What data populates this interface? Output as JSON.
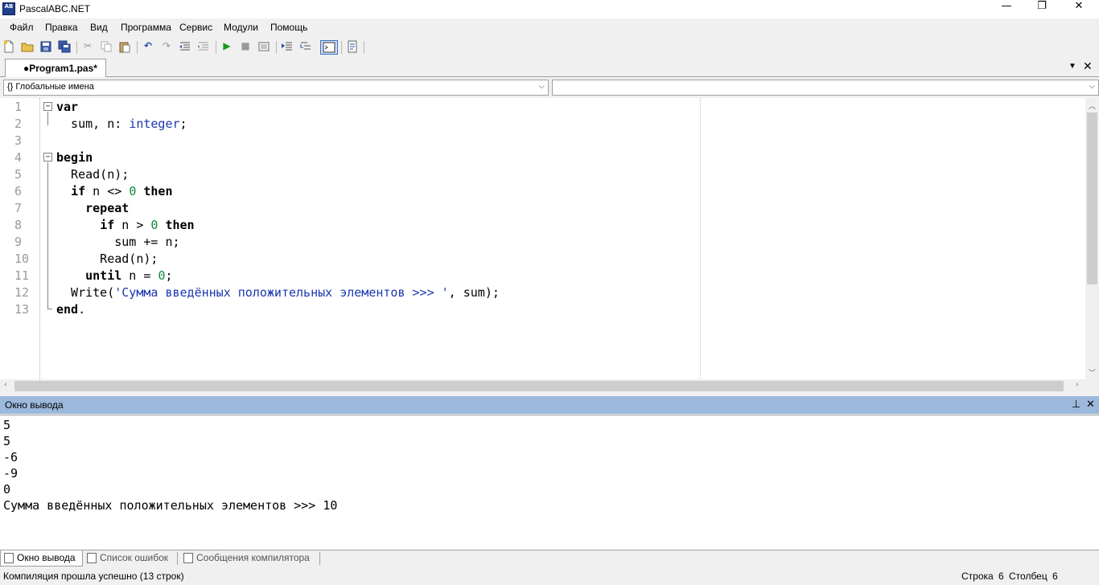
{
  "window": {
    "title": "PascalABC.NET",
    "icon_text": "AB",
    "min": "—",
    "max": "❐",
    "close": "✕"
  },
  "menu": [
    "Файл",
    "Правка",
    "Вид",
    "Программа",
    "Сервис",
    "Модули",
    "Помощь"
  ],
  "toolbar_icons": [
    "new-file-icon",
    "open-file-icon",
    "save-icon",
    "save-all-icon",
    "cut-icon",
    "copy-icon",
    "paste-icon",
    "undo-icon",
    "redo-icon",
    "unindent-icon",
    "indent-icon",
    "run-icon",
    "stop-icon",
    "compile-icon",
    "step-icon",
    "step-into-icon",
    "output-window-icon",
    "debug-icon"
  ],
  "tab": {
    "label": "●Program1.pas*"
  },
  "nav": {
    "left_combo": "{} Глобальные имена",
    "right_combo": ""
  },
  "editor": {
    "line_numbers": [
      "1",
      "2",
      "3",
      "4",
      "5",
      "6",
      "7",
      "8",
      "9",
      "10",
      "11",
      "12",
      "13"
    ],
    "lines": [
      [
        {
          "t": "var",
          "c": "kw"
        }
      ],
      [
        {
          "t": "  sum, n: ",
          "c": ""
        },
        {
          "t": "integer",
          "c": "ty"
        },
        {
          "t": ";",
          "c": ""
        }
      ],
      [],
      [
        {
          "t": "begin",
          "c": "kw"
        }
      ],
      [
        {
          "t": "  Read(n);",
          "c": ""
        }
      ],
      [
        {
          "t": "  ",
          "c": ""
        },
        {
          "t": "if",
          "c": "kw"
        },
        {
          "t": " n <> ",
          "c": ""
        },
        {
          "t": "0",
          "c": "num"
        },
        {
          "t": " ",
          "c": ""
        },
        {
          "t": "then",
          "c": "kw"
        }
      ],
      [
        {
          "t": "    ",
          "c": ""
        },
        {
          "t": "repeat",
          "c": "kw"
        }
      ],
      [
        {
          "t": "      ",
          "c": ""
        },
        {
          "t": "if",
          "c": "kw"
        },
        {
          "t": " n > ",
          "c": ""
        },
        {
          "t": "0",
          "c": "num"
        },
        {
          "t": " ",
          "c": ""
        },
        {
          "t": "then",
          "c": "kw"
        }
      ],
      [
        {
          "t": "        sum += n;",
          "c": ""
        }
      ],
      [
        {
          "t": "      Read(n);",
          "c": ""
        }
      ],
      [
        {
          "t": "    ",
          "c": ""
        },
        {
          "t": "until",
          "c": "kw"
        },
        {
          "t": " n = ",
          "c": ""
        },
        {
          "t": "0",
          "c": "num"
        },
        {
          "t": ";",
          "c": ""
        }
      ],
      [
        {
          "t": "  Write(",
          "c": ""
        },
        {
          "t": "'Сумма введённых положительных элементов >>> '",
          "c": "str"
        },
        {
          "t": ", sum);",
          "c": ""
        }
      ],
      [
        {
          "t": "end",
          "c": "kw"
        },
        {
          "t": ".",
          "c": ""
        }
      ]
    ]
  },
  "output": {
    "title": "Окно вывода",
    "pin": "⊥",
    "close": "✕",
    "lines": [
      "5",
      "5",
      "-6",
      "-9",
      "0",
      "Сумма введённых положительных элементов >>> 10"
    ]
  },
  "bottom_tabs": [
    "Окно вывода",
    "Список ошибок",
    "Сообщения компилятора"
  ],
  "status": {
    "message": "Компиляция прошла успешно (13 строк)",
    "row_label": "Строка",
    "row": "6",
    "col_label": "Столбец",
    "col": "6"
  }
}
